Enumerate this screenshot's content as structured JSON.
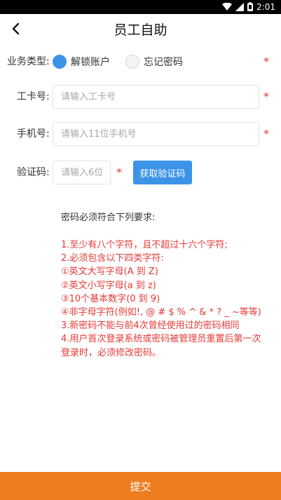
{
  "status_bar": {
    "time": "2:01",
    "icons": [
      "wifi-icon",
      "signal-icon",
      "battery-icon"
    ]
  },
  "header": {
    "title": "员工自助",
    "back_icon": "back-arrow-icon"
  },
  "form": {
    "business_type": {
      "label": "业务类型:",
      "options": [
        {
          "label": "解锁账户",
          "checked": true
        },
        {
          "label": "忘记密码",
          "checked": false
        }
      ],
      "required_mark": "*"
    },
    "employee_id": {
      "label": "工卡号:",
      "placeholder": "请输入工卡号",
      "value": "",
      "required_mark": "*"
    },
    "phone": {
      "label": "手机号:",
      "placeholder": "请输入11位手机号",
      "value": "",
      "required_mark": "*"
    },
    "verification": {
      "label": "验证码:",
      "placeholder": "请输入6位",
      "value": "",
      "required_mark": "*",
      "get_code_label": "获取验证码"
    }
  },
  "password_rules": {
    "heading": "密码必须符合下列要求:",
    "items": [
      "1.至少有八个字符，且不超过十六个字符;",
      "2.必须包含以下四类字符:",
      "①英文大写字母(A 到 Z)",
      "②英文小写字母(a 到 z)",
      "③10个基本数字(0 到 9)",
      "④非字母字符(例如!, @ # $ % ^ & * ? _ ~等等)",
      "3.新密码不能与前4次曾经使用过的密码相同",
      "4.用户首次登录系统或密码被管理员重置后第一次",
      "登录时，必须修改密码。"
    ]
  },
  "submit": {
    "label": "提交"
  },
  "colors": {
    "accent": "#3b94e8",
    "warning_text": "#e53935",
    "submit_bg": "#ee7d1f",
    "status_bar": "#000000"
  }
}
